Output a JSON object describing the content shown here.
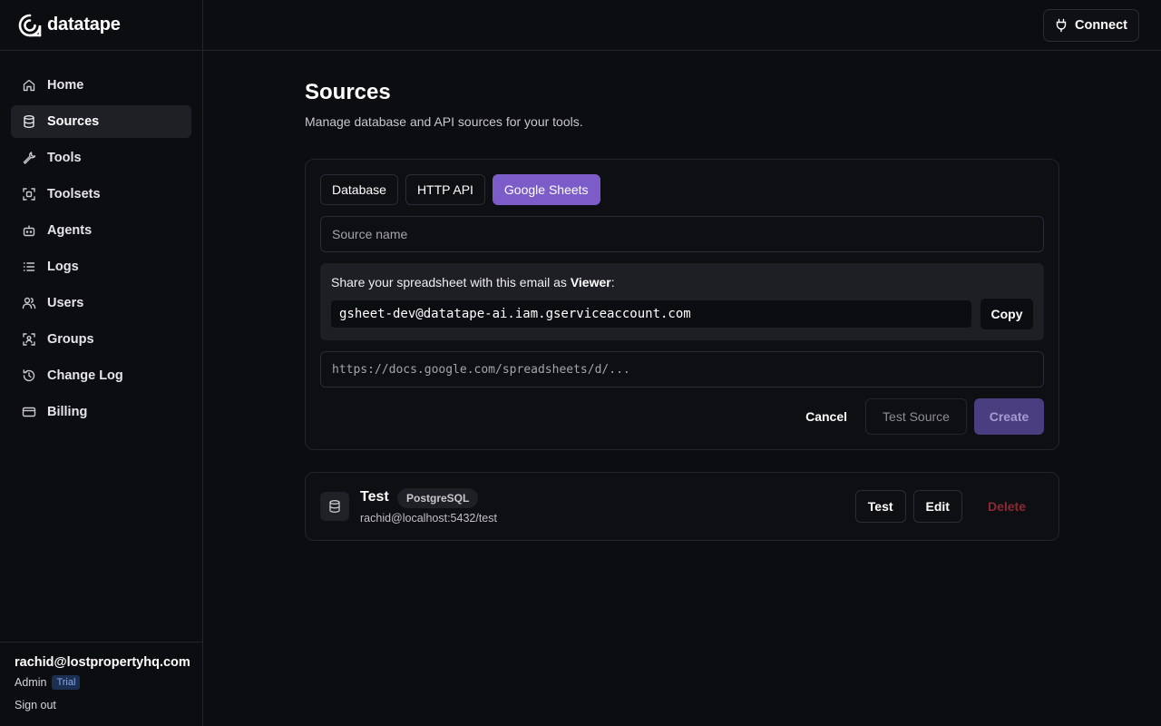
{
  "brand": {
    "name": "datatape"
  },
  "topbar": {
    "connect_label": "Connect"
  },
  "sidebar": {
    "items": [
      {
        "label": "Home",
        "icon": "home-icon"
      },
      {
        "label": "Sources",
        "icon": "database-icon",
        "active": true
      },
      {
        "label": "Tools",
        "icon": "wrench-icon"
      },
      {
        "label": "Toolsets",
        "icon": "toolset-icon"
      },
      {
        "label": "Agents",
        "icon": "bot-icon"
      },
      {
        "label": "Logs",
        "icon": "list-icon"
      },
      {
        "label": "Users",
        "icon": "users-icon"
      },
      {
        "label": "Groups",
        "icon": "group-icon"
      },
      {
        "label": "Change Log",
        "icon": "history-icon"
      },
      {
        "label": "Billing",
        "icon": "credit-card-icon"
      }
    ],
    "footer": {
      "email": "rachid@lostpropertyhq.com",
      "role": "Admin",
      "plan_badge": "Trial",
      "sign_out": "Sign out"
    }
  },
  "page": {
    "title": "Sources",
    "subtitle": "Manage database and API sources for your tools."
  },
  "form": {
    "tabs": [
      "Database",
      "HTTP API",
      "Google Sheets"
    ],
    "active_tab": "Google Sheets",
    "source_name_placeholder": "Source name",
    "share_text_prefix": "Share your spreadsheet with this email as ",
    "share_text_role": "Viewer",
    "share_text_suffix": ":",
    "service_email": "gsheet-dev@datatape-ai.iam.gserviceaccount.com",
    "copy_label": "Copy",
    "url_placeholder": "https://docs.google.com/spreadsheets/d/...",
    "cancel_label": "Cancel",
    "test_source_label": "Test Source",
    "create_label": "Create"
  },
  "sources": [
    {
      "name": "Test",
      "type": "PostgreSQL",
      "connection": "rachid@localhost:5432/test",
      "test_label": "Test",
      "edit_label": "Edit",
      "delete_label": "Delete"
    }
  ],
  "colors": {
    "background": "#0c0d10",
    "accent": "#7b5cc9",
    "create_disabled": "#4a3d80",
    "danger": "#8a2a35",
    "trial_badge": "#1c2f52"
  }
}
